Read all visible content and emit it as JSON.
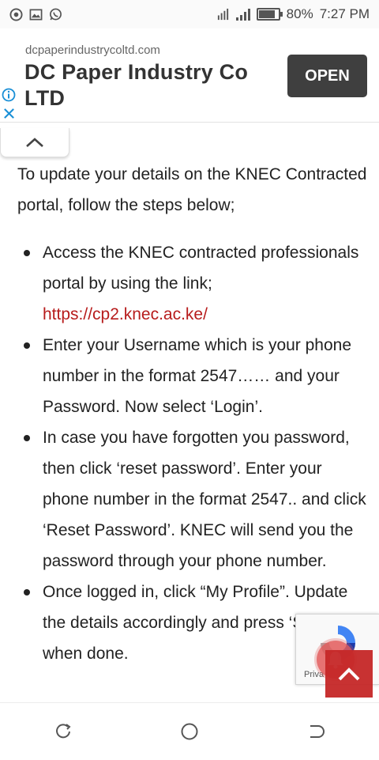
{
  "status_bar": {
    "battery": "80%",
    "battery_level": 0.8,
    "time": "7:27 PM",
    "icons": [
      "chrome-icon",
      "gallery-icon",
      "whatsapp-icon",
      "hotspot-icon",
      "signal-icon",
      "signal-icon",
      "battery-icon"
    ]
  },
  "ad": {
    "domain": "dcpaperindustrycoltd.com",
    "title": "DC Paper Industry Co LTD",
    "open_label": "OPEN"
  },
  "article": {
    "intro": "To update your details on the KNEC Contracted portal, follow the steps below;",
    "steps": [
      {
        "text": "Access the KNEC contracted professionals portal by using the link; ",
        "link": "https://cp2.knec.ac.ke/"
      },
      {
        "text": "Enter your Username which is your phone number in the format 2547…… and your Password. Now select ‘Login’."
      },
      {
        "text": "In case you have forgotten you password, then click ‘reset password’. Enter your phone number in the format 2547.. and click ‘Reset Password’. KNEC will send you the password through your phone number."
      },
      {
        "text": "Once logged in, click “My Profile”. Update the details accordingly and press ‘Save’ when done."
      }
    ]
  },
  "recaptcha": {
    "text": "Priva"
  },
  "colors": {
    "link": "#b71c1c",
    "scroll_top": "#c62828",
    "ad_button": "#3f3f3f"
  }
}
